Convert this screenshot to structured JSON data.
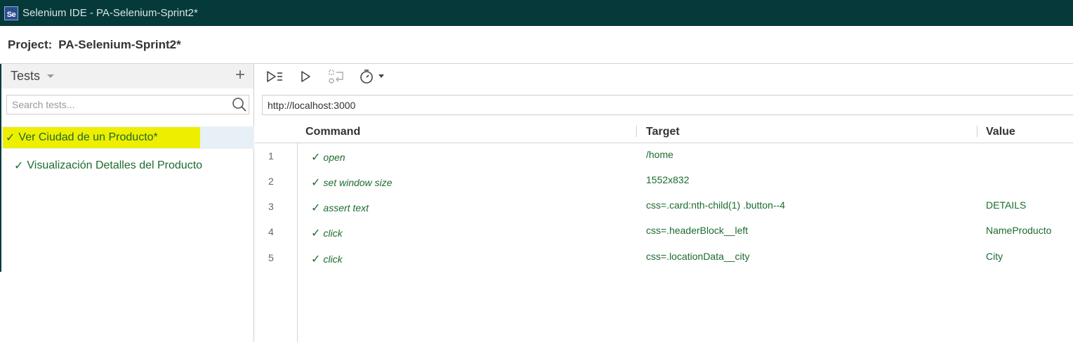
{
  "window": {
    "logo_text": "Se",
    "title": "Selenium IDE - PA-Selenium-Sprint2*"
  },
  "project": {
    "label": "Project:",
    "name": "PA-Selenium-Sprint2*"
  },
  "sidebar": {
    "title": "Tests",
    "add_label": "+",
    "search": {
      "placeholder": "Search tests...",
      "value": ""
    },
    "tests": [
      {
        "check": "✓",
        "name": "Ver Ciudad de un Producto*",
        "selected": true,
        "highlighted": true
      },
      {
        "check": "✓",
        "name": "Visualización Detalles del Producto",
        "selected": false,
        "highlighted": false
      }
    ]
  },
  "toolbar": {
    "icons": [
      "run-all-tests-icon",
      "run-current-test-icon",
      "step-over-icon",
      "test-speed-timer-icon"
    ]
  },
  "url_bar": {
    "value": "http://localhost:3000"
  },
  "table": {
    "headers": {
      "command": "Command",
      "target": "Target",
      "value": "Value"
    },
    "rows": [
      {
        "num": "1",
        "check": "✓",
        "command": "open",
        "target": "/home",
        "value": ""
      },
      {
        "num": "2",
        "check": "✓",
        "command": "set window size",
        "target": "1552x832",
        "value": ""
      },
      {
        "num": "3",
        "check": "✓",
        "command": "assert text",
        "target": "css=.card:nth-child(1) .button--4",
        "value": "DETAILS"
      },
      {
        "num": "4",
        "check": "✓",
        "command": "click",
        "target": "css=.headerBlock__left",
        "value": "NameProducto"
      },
      {
        "num": "5",
        "check": "✓",
        "command": "click",
        "target": "css=.locationData__city",
        "value": "City"
      }
    ]
  },
  "colors": {
    "titlebar": "#063a3a",
    "pass_green": "#1c6b2f",
    "highlight": "#eeee00",
    "selected_row": "#e8f0f7"
  }
}
